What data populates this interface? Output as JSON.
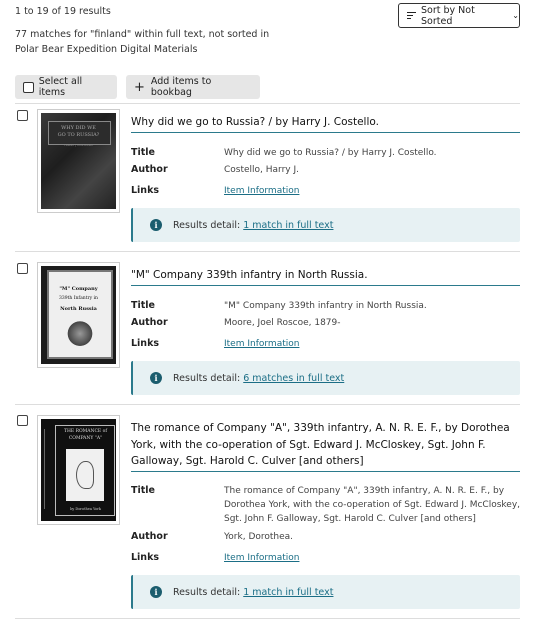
{
  "results_summary": {
    "count_text": "1 to 19 of 19 results",
    "matches_text": "77 matches for \"finland\" within full text, not sorted in Polar Bear Expedition Digital Materials"
  },
  "sort": {
    "label": "Sort by Not Sorted"
  },
  "actions": {
    "select_all": "Select all items",
    "add_bookbag": "Add items to bookbag"
  },
  "field_labels": {
    "title": "Title",
    "author": "Author",
    "links": "Links"
  },
  "results": [
    {
      "title": "Why did we go to Russia? / by Harry J. Costello.",
      "title_field": "Why did we go to Russia? / by Harry J. Costello.",
      "author": "Costello, Harry J.",
      "link_text": "Item Information",
      "detail_label": "Results detail:",
      "detail_link": "1 match in full text",
      "thumb_lines": [
        "WHY DID WE",
        "GO TO RUSSIA?",
        "HARRY J COSTELLO"
      ]
    },
    {
      "title": "\"M\" Company 339th infantry in North Russia.",
      "title_field": "\"M\" Company 339th infantry in North Russia.",
      "author": "Moore, Joel Roscoe, 1879-",
      "link_text": "Item Information",
      "detail_label": "Results detail:",
      "detail_link": "6 matches in full text",
      "thumb_lines": [
        "\"M\" Company",
        "339th Infantry in",
        "North Russia"
      ]
    },
    {
      "title": "The romance of Company \"A\", 339th infantry, A. N. R. E. F., by Dorothea York, with the co-operation of Sgt. Edward J. McCloskey, Sgt. John F. Galloway, Sgt. Harold C. Culver [and others]",
      "title_field": "The romance of Company \"A\", 339th infantry, A. N. R. E. F., by Dorothea York, with the co-operation of Sgt. Edward J. McCloskey, Sgt. John F. Galloway, Sgt. Harold C. Culver [and others]",
      "author": "York, Dorothea.",
      "link_text": "Item Information",
      "detail_label": "Results detail:",
      "detail_link": "1 match in full text",
      "thumb_lines": [
        "THE ROMANCE of",
        "COMPANY \"A\"",
        "by Dorothea York"
      ]
    }
  ],
  "colors": {
    "accent": "#2b7a8c",
    "link": "#1b6e86",
    "detail_bg": "#e7f1f3",
    "info_icon": "#1b5d6e"
  },
  "icons": {
    "info": "info-icon",
    "sort": "sort-lines-icon",
    "chevron": "chevron-down-icon",
    "plus": "plus-icon"
  }
}
